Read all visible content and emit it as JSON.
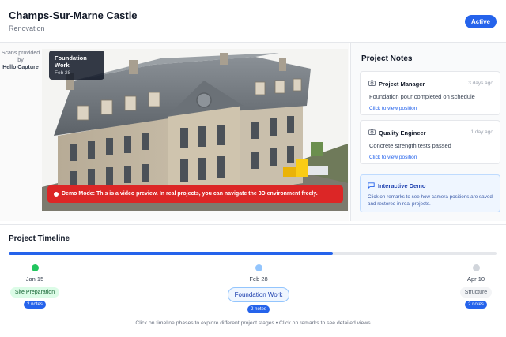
{
  "header": {
    "title": "Champs-Sur-Marne Castle",
    "subtitle": "Renovation",
    "status": "Active"
  },
  "viewer": {
    "credit_prefix": "Scans provided by",
    "credit_name": "Hello Capture",
    "active_phase": {
      "name": "Foundation Work",
      "date": "Feb 28"
    },
    "demo_banner": "Demo Mode: This is a video preview. In real projects, you can navigate the 3D environment freely."
  },
  "notes": {
    "title": "Project Notes",
    "items": [
      {
        "role": "Project Manager",
        "time": "3 days ago",
        "text": "Foundation pour completed on schedule",
        "link": "Click to view position",
        "icon": "camera-icon"
      },
      {
        "role": "Quality Engineer",
        "time": "1 day ago",
        "text": "Concrete strength tests passed",
        "link": "Click to view position",
        "icon": "camera-icon"
      }
    ],
    "demo": {
      "title": "Interactive Demo",
      "icon": "chat-icon",
      "text": "Click on remarks to see how camera positions are saved and restored in real projects."
    }
  },
  "timeline": {
    "title": "Project Timeline",
    "progress": 0.665,
    "phases": [
      {
        "date": "Jan 15",
        "label": "Site Preparation",
        "notes": "2 notes",
        "state": "completed",
        "dot_color": "#22c55e"
      },
      {
        "date": "Feb 28",
        "label": "Foundation Work",
        "notes": "2 notes",
        "state": "active",
        "dot_color": "#93c5fd"
      },
      {
        "date": "Apr 10",
        "label": "Structure",
        "notes": "2 notes",
        "state": "upcoming",
        "dot_color": "#d1d5db"
      }
    ],
    "hint": "Click on timeline phases to explore different project stages • Click on remarks to see detailed views"
  },
  "colors": {
    "accent": "#2563eb",
    "danger": "#dc2626",
    "success": "#22c55e"
  }
}
